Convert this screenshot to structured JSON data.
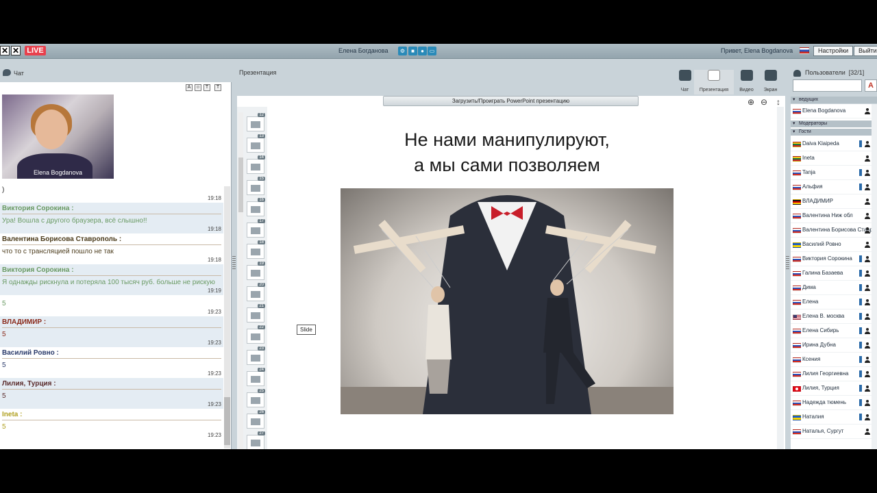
{
  "topbar": {
    "live": "LIVE",
    "host_name": "Елена Богданова",
    "greeting": "Привет, Elena Bogdanova",
    "settings": "Настройки",
    "exit": "Выйти"
  },
  "chat": {
    "title": "Чат",
    "video_name": "Elena Bogdanova",
    "messages": [
      {
        "author": "",
        "text": ")",
        "time": "19:18",
        "alt": false,
        "color": "#222222"
      },
      {
        "author": "Виктория Сорокина :",
        "text": "Ура! Вошла с другого браузера, всё слышно!!",
        "time": "19:18",
        "alt": true,
        "color": "#6a9a64"
      },
      {
        "author": "Валентина Борисова Ставрополь :",
        "text": "что то с трансляцией пошло не так",
        "time": "19:18",
        "alt": false,
        "color": "#4a3a1a"
      },
      {
        "author": "Виктория Сорокина :",
        "text": "Я однажды рискнула и потеряла 100 тысяч руб. больше не рискую",
        "time": "19:19",
        "alt": true,
        "color": "#6a9a64"
      },
      {
        "author": "",
        "text": "5",
        "time": "19:23",
        "alt": false,
        "color": "#6a9a64"
      },
      {
        "author": "ВЛАДИМИР :",
        "text": "5",
        "time": "19:23",
        "alt": true,
        "color": "#8a2a1a"
      },
      {
        "author": "Василий Ровно :",
        "text": "5",
        "time": "19:23",
        "alt": false,
        "color": "#2a3a6a"
      },
      {
        "author": "Лилия, Турция :",
        "text": "5",
        "time": "19:23",
        "alt": true,
        "color": "#5a2a2a"
      },
      {
        "author": "Ineta :",
        "text": "5",
        "time": "19:23",
        "alt": false,
        "color": "#b0a020"
      }
    ]
  },
  "presentation": {
    "title": "Презентация",
    "upload": "Загрузить/Проиграть PowerPoint презентацию",
    "slide_tip": "Slide",
    "slide_title_1": "Не нами манипулируют,",
    "slide_title_2": "а мы сами позволяем",
    "thumb_numbers": [
      "12",
      "13",
      "14",
      "15",
      "16",
      "17",
      "18",
      "19",
      "20",
      "21",
      "22",
      "23",
      "24",
      "25",
      "26",
      "27"
    ],
    "modes": {
      "chat": "Чат",
      "presentation": "Презентация",
      "video": "Видео",
      "screen": "Экран"
    }
  },
  "users": {
    "title": "Пользователи",
    "count": "[32/1]",
    "az": "A",
    "groups": {
      "hosts": "ведущих",
      "moderators": "Модераторы",
      "guests": "Гости"
    },
    "host": {
      "name": "Elena Bogdanova",
      "flag": "ru"
    },
    "guests": [
      {
        "name": "Daiva Klaipeda",
        "flag": "lt",
        "cam": true
      },
      {
        "name": "Ineta",
        "flag": "lt",
        "cam": false
      },
      {
        "name": "Tanja",
        "flag": "ru",
        "cam": true
      },
      {
        "name": "Альфия",
        "flag": "ru",
        "cam": true
      },
      {
        "name": "ВЛАДИМИР",
        "flag": "de",
        "cam": false
      },
      {
        "name": "Валентина Ниж обл",
        "flag": "ru",
        "cam": false
      },
      {
        "name": "Валентина Борисова Ставрополь",
        "flag": "ru",
        "cam": false
      },
      {
        "name": "Василий Ровно",
        "flag": "ua",
        "cam": false
      },
      {
        "name": "Виктория Сорокина",
        "flag": "ru",
        "cam": true
      },
      {
        "name": "Галина Базаева",
        "flag": "ru",
        "cam": true
      },
      {
        "name": "Дима",
        "flag": "ru",
        "cam": true
      },
      {
        "name": "Елена",
        "flag": "ru",
        "cam": true
      },
      {
        "name": "Елена В. москва",
        "flag": "us",
        "cam": true
      },
      {
        "name": "Елена Сибирь",
        "flag": "ru",
        "cam": true
      },
      {
        "name": "Ирина Дубна",
        "flag": "ru",
        "cam": true
      },
      {
        "name": "Ксения",
        "flag": "ru",
        "cam": true
      },
      {
        "name": "Лилия Георгиевна",
        "flag": "ru",
        "cam": true
      },
      {
        "name": "Лилия, Турция",
        "flag": "tr",
        "cam": true
      },
      {
        "name": "Надежда тюмень",
        "flag": "ru",
        "cam": true
      },
      {
        "name": "Наталия",
        "flag": "ua",
        "cam": true
      },
      {
        "name": "Наталья, Сургут",
        "flag": "ru",
        "cam": false
      }
    ]
  }
}
